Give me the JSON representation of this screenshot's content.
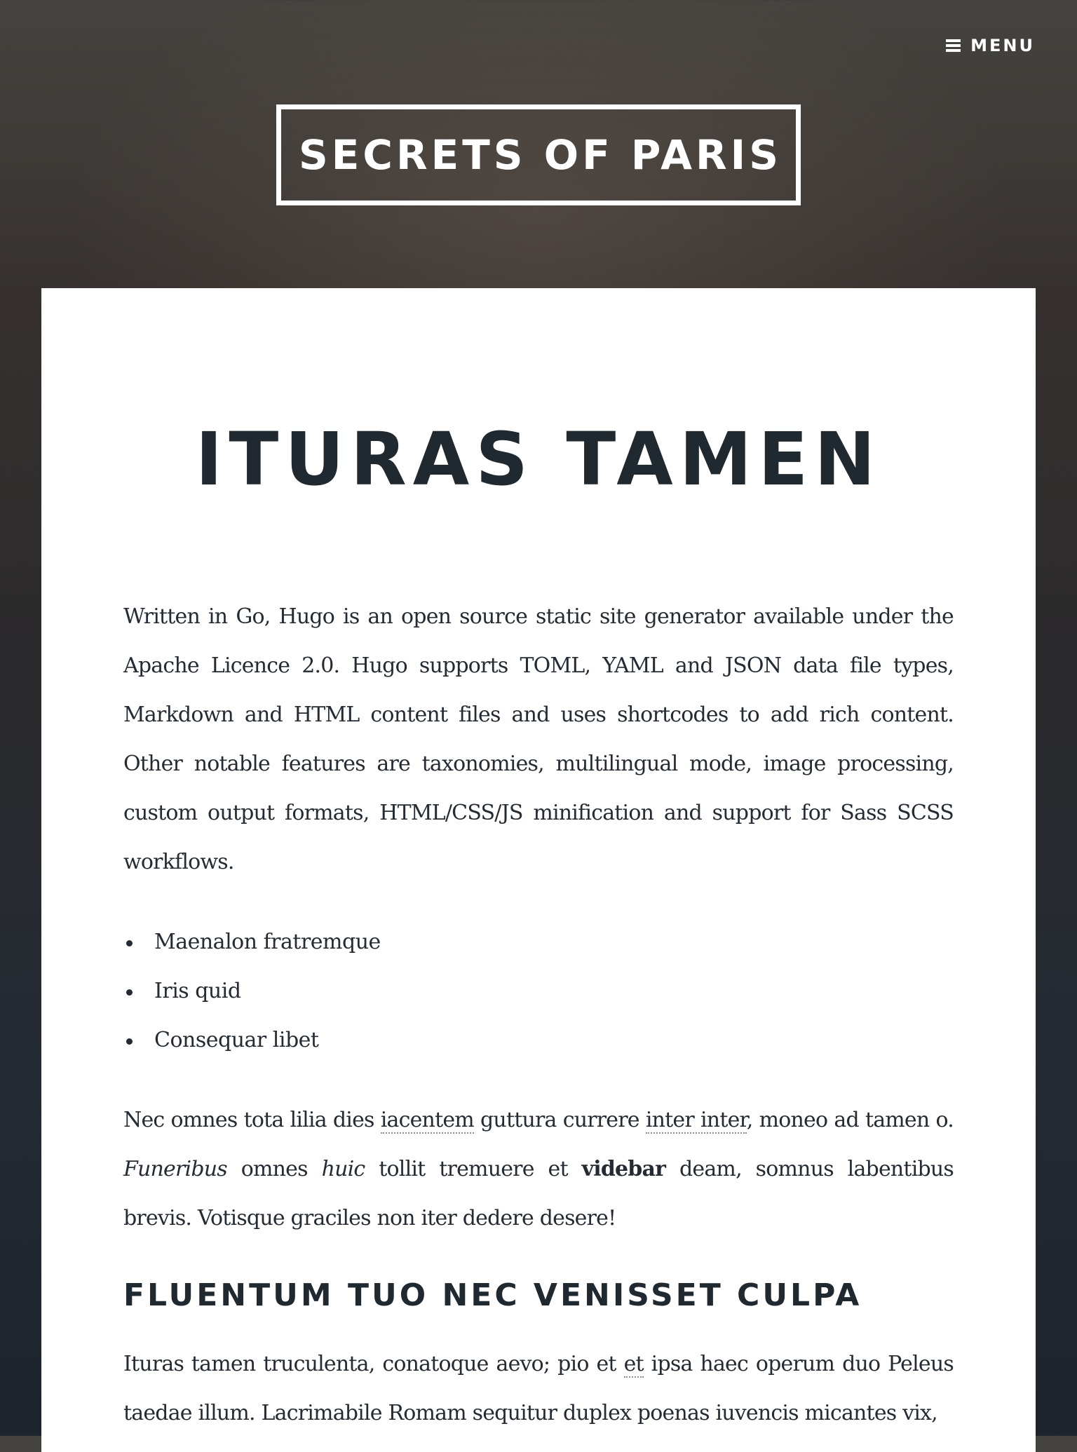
{
  "header": {
    "menu_label": "MENU",
    "menu_icon": "hamburger-icon",
    "site_title": "SECRETS OF PARIS"
  },
  "colors": {
    "card_background": "#ffffff",
    "heading_text": "#202830",
    "body_text": "#242b33",
    "header_text": "#ffffff"
  },
  "post": {
    "title": "ITURAS TAMEN",
    "intro_paragraph": "Written in Go, Hugo is an open source static site generator available under the Apache Licence 2.0. Hugo supports TOML, YAML and JSON data file types, Markdown and HTML content files and uses shortcodes to add rich content. Other notable features are taxonomies, multilingual mode, image processing, custom output formats, HTML/CSS/JS minification and support for Sass SCSS workflows.",
    "list_items": [
      "Maenalon fratremque",
      "Iris quid",
      "Consequar libet"
    ],
    "paragraph_2": {
      "t1": "Nec omnes tota lilia dies ",
      "abbr1": "iacentem",
      "t2": " guttura currere ",
      "abbr2": "inter inter",
      "t3": ", moneo ad tamen o. ",
      "em1": "Funeribus",
      "t4": " omnes ",
      "em2": "huic",
      "t5": " tollit tremuere et ",
      "strong1": "videbar",
      "t6": " deam, somnus labentibus brevis. Votisque graciles non iter dedere desere!"
    },
    "section_heading": "FLUENTUM TUO NEC VENISSET CULPA",
    "paragraph_3": {
      "t1": "Ituras tamen truculenta, conatoque aevo; pio et ",
      "abbr1": "et",
      "t2": " ipsa haec operum duo Peleus taedae illum. Lacrimabile Romam sequitur duplex poenas iuvencis micantes vix,"
    }
  }
}
